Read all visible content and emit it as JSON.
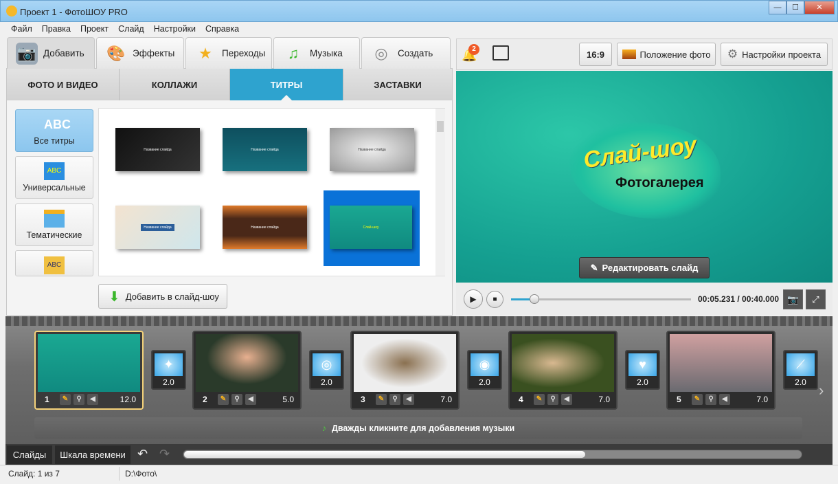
{
  "window": {
    "title": "Проект 1 - ФотоШОУ PRO",
    "min": "—",
    "max": "☐",
    "close": "✕"
  },
  "menu": [
    "Файл",
    "Правка",
    "Проект",
    "Слайд",
    "Настройки",
    "Справка"
  ],
  "main_tabs": [
    {
      "label": "Добавить",
      "icon": "camera-icon"
    },
    {
      "label": "Эффекты",
      "icon": "palette-icon"
    },
    {
      "label": "Переходы",
      "icon": "star-icon"
    },
    {
      "label": "Музыка",
      "icon": "music-note-icon"
    },
    {
      "label": "Создать",
      "icon": "film-reel-icon"
    }
  ],
  "sub_tabs": [
    "ФОТО И ВИДЕО",
    "КОЛЛАЖИ",
    "ТИТРЫ",
    "ЗАСТАВКИ"
  ],
  "active_sub_tab": "ТИТРЫ",
  "categories": [
    {
      "label": "Все титры",
      "icon": "ABC"
    },
    {
      "label": "Универсальные",
      "icon": "ABC"
    },
    {
      "label": "Тематические",
      "icon": "gift"
    },
    {
      "label": "",
      "icon": "ABC"
    }
  ],
  "templates": [
    {
      "caption": "Название слайда"
    },
    {
      "caption": "Название слайда"
    },
    {
      "caption": "Название слайда"
    },
    {
      "caption": "Название слайда"
    },
    {
      "caption": "Название слайда"
    },
    {
      "caption": "Слай-шоу"
    }
  ],
  "add_button": "Добавить в слайд-шоу",
  "toolbar": {
    "notifications": "2",
    "aspect": "16:9",
    "photo_position": "Положение фото",
    "project_settings": "Настройки проекта"
  },
  "preview": {
    "title": "Слай-шоу",
    "subtitle": "Фотогалерея",
    "edit_button": "Редактировать слайд"
  },
  "player": {
    "time": "00:05.231 / 00:40.000",
    "progress": 0.13
  },
  "slides": [
    {
      "n": "1",
      "dur": "12.0"
    },
    {
      "n": "2",
      "dur": "5.0"
    },
    {
      "n": "3",
      "dur": "7.0"
    },
    {
      "n": "4",
      "dur": "7.0"
    },
    {
      "n": "5",
      "dur": "7.0"
    }
  ],
  "transitions": [
    "2.0",
    "2.0",
    "2.0",
    "2.0",
    "2.0"
  ],
  "music_hint": "Дважды кликните для добавления музыки",
  "bottom_tabs": [
    "Слайды",
    "Шкала времени"
  ],
  "status": {
    "slide": "Слайд: 1 из 7",
    "path": "D:\\Фото\\"
  },
  "colors": {
    "accent": "#2ea3cf",
    "preview_bg": "#15a091",
    "selected": "#0a72d8"
  }
}
